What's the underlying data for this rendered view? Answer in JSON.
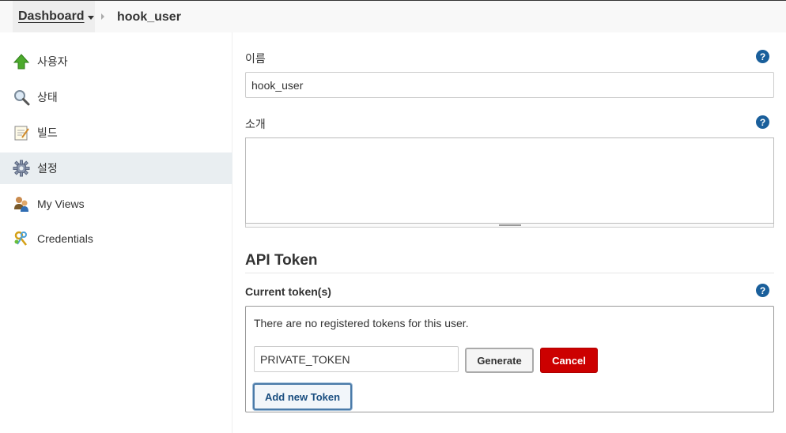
{
  "breadcrumb": {
    "dashboard": "Dashboard",
    "user": "hook_user"
  },
  "sidebar": {
    "items": [
      {
        "label": "사용자",
        "icon": "up-arrow-icon"
      },
      {
        "label": "상태",
        "icon": "magnifier-icon"
      },
      {
        "label": "빌드",
        "icon": "notepad-icon"
      },
      {
        "label": "설정",
        "icon": "gear-icon"
      },
      {
        "label": "My Views",
        "icon": "users-icon"
      },
      {
        "label": "Credentials",
        "icon": "keys-icon"
      }
    ],
    "active_index": 3
  },
  "form": {
    "name_label": "이름",
    "name_value": "hook_user",
    "description_label": "소개",
    "description_value": "",
    "help_glyph": "?"
  },
  "api_token": {
    "title": "API Token",
    "current_label": "Current token(s)",
    "no_tokens_text": "There are no registered tokens for this user.",
    "new_token_value": "PRIVATE_TOKEN",
    "generate_label": "Generate",
    "cancel_label": "Cancel",
    "add_label": "Add new Token"
  },
  "colors": {
    "help": "#1a5f9b",
    "cancel": "#cc0000",
    "active_sidebar": "#e9eef1"
  }
}
